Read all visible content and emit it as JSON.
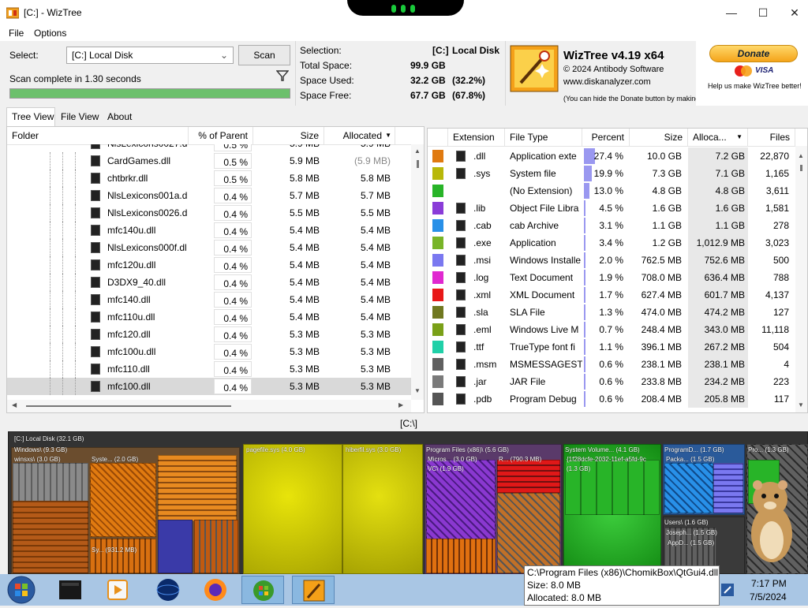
{
  "window": {
    "title": "[C:]  - WizTree"
  },
  "menu": {
    "file": "File",
    "options": "Options"
  },
  "scan": {
    "select_label": "Select:",
    "drive_value": "[C:] Local Disk",
    "scan_button": "Scan",
    "status": "Scan complete in 1.30 seconds",
    "progress_fraction": 1.0
  },
  "selection": {
    "selection_label": "Selection:",
    "selection_drive": "[C:]",
    "selection_name": "Local Disk",
    "total_label": "Total Space:",
    "total_value": "99.9 GB",
    "used_label": "Space Used:",
    "used_value": "32.2 GB",
    "used_pct": "(32.2%)",
    "free_label": "Space Free:",
    "free_value": "67.7 GB",
    "free_pct": "(67.8%)"
  },
  "about": {
    "app_name": "WizTree v4.19 x64",
    "copyright": "© 2024 Antibody Software",
    "website": "www.diskanalyzer.com",
    "donate_note": "(You can hide the Donate button by making a donation)",
    "donate_button": "Donate",
    "donate_help": "Help us make WizTree better!",
    "card1": "MasterCard",
    "card2": "VISA"
  },
  "tabs": {
    "tree_view": "Tree View",
    "file_view": "File View",
    "about": "About"
  },
  "tree": {
    "headers": {
      "folder": "Folder",
      "pct": "% of Parent",
      "size": "Size",
      "allocated": "Allocated"
    },
    "partial_row": {
      "name": "NlsLexicons0027.d",
      "pct": "0.5 %",
      "size": "5.9 MB",
      "allocated": "5.9 MB"
    },
    "rows": [
      {
        "name": "CardGames.dll",
        "pct": "0.5 %",
        "size": "5.9 MB",
        "allocated": "(5.9 MB)"
      },
      {
        "name": "chtbrkr.dll",
        "pct": "0.5 %",
        "size": "5.8 MB",
        "allocated": "5.8 MB"
      },
      {
        "name": "NlsLexicons001a.d",
        "pct": "0.4 %",
        "size": "5.7 MB",
        "allocated": "5.7 MB"
      },
      {
        "name": "NlsLexicons0026.d",
        "pct": "0.4 %",
        "size": "5.5 MB",
        "allocated": "5.5 MB"
      },
      {
        "name": "mfc140u.dll",
        "pct": "0.4 %",
        "size": "5.4 MB",
        "allocated": "5.4 MB"
      },
      {
        "name": "NlsLexicons000f.dl",
        "pct": "0.4 %",
        "size": "5.4 MB",
        "allocated": "5.4 MB"
      },
      {
        "name": "mfc120u.dll",
        "pct": "0.4 %",
        "size": "5.4 MB",
        "allocated": "5.4 MB"
      },
      {
        "name": "D3DX9_40.dll",
        "pct": "0.4 %",
        "size": "5.4 MB",
        "allocated": "5.4 MB"
      },
      {
        "name": "mfc140.dll",
        "pct": "0.4 %",
        "size": "5.4 MB",
        "allocated": "5.4 MB"
      },
      {
        "name": "mfc110u.dll",
        "pct": "0.4 %",
        "size": "5.4 MB",
        "allocated": "5.4 MB"
      },
      {
        "name": "mfc120.dll",
        "pct": "0.4 %",
        "size": "5.3 MB",
        "allocated": "5.3 MB"
      },
      {
        "name": "mfc100u.dll",
        "pct": "0.4 %",
        "size": "5.3 MB",
        "allocated": "5.3 MB"
      },
      {
        "name": "mfc110.dll",
        "pct": "0.4 %",
        "size": "5.3 MB",
        "allocated": "5.3 MB"
      },
      {
        "name": "mfc100.dll",
        "pct": "0.4 %",
        "size": "5.3 MB",
        "allocated": "5.3 MB"
      }
    ]
  },
  "ext": {
    "headers": {
      "extension": "Extension",
      "file_type": "File Type",
      "percent": "Percent",
      "size": "Size",
      "allocated": "Alloca...",
      "files": "Files"
    },
    "rows": [
      {
        "color": "#e07a10",
        "icon": "dll-icon",
        "ext": ".dll",
        "type": "Application exte",
        "pct": "27.4 %",
        "frac": 0.274,
        "size": "10.0 GB",
        "alloc": "7.2 GB",
        "files": "22,870"
      },
      {
        "color": "#b8b80a",
        "icon": "sys-icon",
        "ext": ".sys",
        "type": "System file",
        "pct": "19.9 %",
        "frac": 0.199,
        "size": "7.3 GB",
        "alloc": "7.1 GB",
        "files": "1,165"
      },
      {
        "color": "#28b428",
        "icon": "none",
        "ext": "",
        "type": "(No Extension)",
        "pct": "13.0 %",
        "frac": 0.13,
        "size": "4.8 GB",
        "alloc": "4.8 GB",
        "files": "3,611"
      },
      {
        "color": "#8a3cd8",
        "icon": "lib-icon",
        "ext": ".lib",
        "type": "Object File Libra",
        "pct": "4.5 %",
        "frac": 0.045,
        "size": "1.6 GB",
        "alloc": "1.6 GB",
        "files": "1,581"
      },
      {
        "color": "#2890e8",
        "icon": "cab-icon",
        "ext": ".cab",
        "type": "cab Archive",
        "pct": "3.1 %",
        "frac": 0.031,
        "size": "1.1 GB",
        "alloc": "1.1 GB",
        "files": "278"
      },
      {
        "color": "#78b428",
        "icon": "exe-icon",
        "ext": ".exe",
        "type": "Application",
        "pct": "3.4 %",
        "frac": 0.034,
        "size": "1.2 GB",
        "alloc": "1,012.9 MB",
        "files": "3,023"
      },
      {
        "color": "#7a78f0",
        "icon": "msi-icon",
        "ext": ".msi",
        "type": "Windows Installe",
        "pct": "2.0 %",
        "frac": 0.02,
        "size": "762.5 MB",
        "alloc": "752.6 MB",
        "files": "500"
      },
      {
        "color": "#e028d0",
        "icon": "log-icon",
        "ext": ".log",
        "type": "Text Document",
        "pct": "1.9 %",
        "frac": 0.019,
        "size": "708.0 MB",
        "alloc": "636.4 MB",
        "files": "788"
      },
      {
        "color": "#e81818",
        "icon": "xml-icon",
        "ext": ".xml",
        "type": "XML Document",
        "pct": "1.7 %",
        "frac": 0.017,
        "size": "627.4 MB",
        "alloc": "601.7 MB",
        "files": "4,137"
      },
      {
        "color": "#707820",
        "icon": "sla-icon",
        "ext": ".sla",
        "type": "SLA File",
        "pct": "1.3 %",
        "frac": 0.013,
        "size": "474.0 MB",
        "alloc": "474.2 MB",
        "files": "127"
      },
      {
        "color": "#7aa018",
        "icon": "eml-icon",
        "ext": ".eml",
        "type": "Windows Live M",
        "pct": "0.7 %",
        "frac": 0.007,
        "size": "248.4 MB",
        "alloc": "343.0 MB",
        "files": "11,118"
      },
      {
        "color": "#20d0a8",
        "icon": "ttf-icon",
        "ext": ".ttf",
        "type": "TrueType font fi",
        "pct": "1.1 %",
        "frac": 0.011,
        "size": "396.1 MB",
        "alloc": "267.2 MB",
        "files": "504"
      },
      {
        "color": "#606060",
        "icon": "msm-icon",
        "ext": ".msm",
        "type": "MSMESSAGESTC",
        "pct": "0.6 %",
        "frac": 0.006,
        "size": "238.1 MB",
        "alloc": "238.1 MB",
        "files": "4"
      },
      {
        "color": "#7a7a7a",
        "icon": "jar-icon",
        "ext": ".jar",
        "type": "JAR File",
        "pct": "0.6 %",
        "frac": 0.006,
        "size": "233.8 MB",
        "alloc": "234.2 MB",
        "files": "223"
      },
      {
        "color": "#555555",
        "icon": "pdb-icon",
        "ext": ".pdb",
        "type": "Program Debug",
        "pct": "0.6 %",
        "frac": 0.006,
        "size": "208.4 MB",
        "alloc": "205.8 MB",
        "files": "117"
      }
    ]
  },
  "path_bar": "[C:\\]",
  "treemap": {
    "root": "[C:] Local Disk (32.1 GB)",
    "windows": "Windows\\ (9.3 GB)",
    "winsxs": "winsxs\\ (3.0 GB)",
    "system1": "Syste... (2.0 GB)",
    "sy": "Sy... (931.2 MB)",
    "pagefile": "pagefile.sys (4.0 GB)",
    "hiberfil": "hiberfil.sys (3.0 GB)",
    "program_files": "Program Files (x86)\\ (5.6 GB)",
    "micros": "Micros... (3.0 GB)",
    "vc": "VC\\ (1.9 GB)",
    "r": "R... (790.3 MB)",
    "system_volume": "System Volume... (4.1 GB)",
    "guid": "{1f28dcfe-2032-11ef-a5fd-9c",
    "guid_size": "(1.3 GB)",
    "programd": "ProgramD... (1.7 GB)",
    "packa": "Packa... (1.5 GB)",
    "users": "Users\\ (1.6 GB)",
    "joseph": "Joseph... (1.5 GB)",
    "appd": "AppD... (1.5 GB)",
    "pro": "Pro... (1.3 GB)"
  },
  "tooltip": {
    "path": "C:\\Program Files (x86)\\ChomikBox\\QtGui4.dll",
    "size": "Size: 8.0 MB",
    "allocated": "Allocated: 8.0 MB"
  },
  "taskbar": {
    "time": "7:17 PM",
    "date": "7/5/2024"
  }
}
